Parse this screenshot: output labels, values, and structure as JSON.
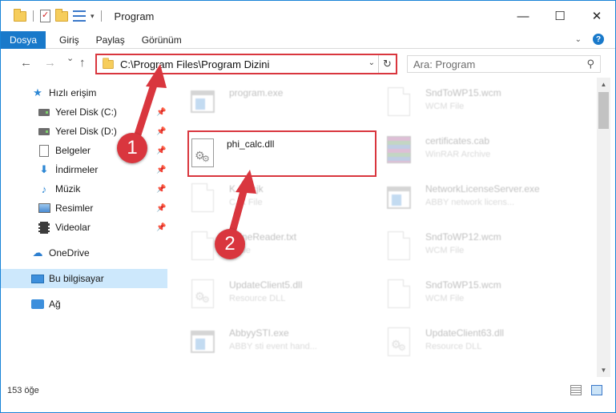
{
  "window": {
    "title": "Program",
    "minimize": "—",
    "maximize": "☐",
    "close": "✕"
  },
  "ribbon": {
    "file_tab": "Dosya",
    "tabs": [
      "Giriş",
      "Paylaş",
      "Görünüm"
    ],
    "collapse_icon": "chevron-down-icon",
    "help": "?"
  },
  "nav": {
    "back": "←",
    "forward": "→",
    "recent": "⌄",
    "up": "↑",
    "address": "C:\\Program Files\\Program Dizini",
    "dropdown": "⌄",
    "refresh": "↻"
  },
  "search": {
    "placeholder": "Ara: Program",
    "icon": "⚲"
  },
  "sidebar": {
    "items": [
      {
        "label": "Hızlı erişim",
        "icon": "star-icon",
        "glyph": "★"
      },
      {
        "label": "Yerel Disk (C:)",
        "icon": "drive-icon",
        "glyph": "",
        "pinned": true
      },
      {
        "label": "Yerel Disk (D:)",
        "icon": "drive-icon",
        "glyph": "",
        "pinned": true
      },
      {
        "label": "Belgeler",
        "icon": "documents-icon",
        "glyph": "",
        "pinned": true
      },
      {
        "label": "İndirmeler",
        "icon": "download-icon",
        "glyph": "⬇",
        "pinned": true
      },
      {
        "label": "Müzik",
        "icon": "music-icon",
        "glyph": "♪",
        "pinned": true
      },
      {
        "label": "Resimler",
        "icon": "pictures-icon",
        "glyph": "",
        "pinned": true
      },
      {
        "label": "Videolar",
        "icon": "videos-icon",
        "glyph": "",
        "pinned": true
      },
      {
        "label": "OneDrive",
        "icon": "cloud-icon",
        "glyph": "☁"
      },
      {
        "label": "Bu bilgisayar",
        "icon": "computer-icon",
        "glyph": "",
        "selected": true
      },
      {
        "label": "Ağ",
        "icon": "network-icon",
        "glyph": ""
      }
    ],
    "pin_glyph": "📌"
  },
  "files": [
    {
      "name": "program.exe",
      "type": "",
      "icon": "exe-icon"
    },
    {
      "name": "SndToWP15.wcm",
      "type": "WCM File",
      "icon": "blank-file-icon"
    },
    {
      "name": "phi_calc.dll",
      "type": "",
      "icon": "dll-gear-icon",
      "highlight": true
    },
    {
      "name": "certificates.cab",
      "type": "WinRAR Archive",
      "icon": "archive-icon"
    },
    {
      "name": "K...n.cjk",
      "type": "CJK File",
      "icon": "blank-file-icon"
    },
    {
      "name": "NetworkLicenseServer.exe",
      "type": "ABBY network licens...",
      "icon": "exe-icon"
    },
    {
      "name": "...fineReader.txt",
      "type": "...File",
      "icon": "blank-file-icon"
    },
    {
      "name": "SndToWP12.wcm",
      "type": "WCM File",
      "icon": "blank-file-icon"
    },
    {
      "name": "UpdateClient5.dll",
      "type": "Resource DLL",
      "icon": "dll-gear-icon"
    },
    {
      "name": "SndToWP15.wcm",
      "type": "WCM File",
      "icon": "blank-file-icon"
    },
    {
      "name": "AbbyySTI.exe",
      "type": "ABBY sti event hand...",
      "icon": "exe-icon"
    },
    {
      "name": "UpdateClient63.dll",
      "type": "Resource DLL",
      "icon": "dll-gear-icon"
    }
  ],
  "status": {
    "count": "153 öğe"
  },
  "annotations": {
    "badge1": "1",
    "badge2": "2",
    "color": "#d9363e"
  },
  "colors": {
    "accent": "#1979ca",
    "selection": "#cde8fc"
  }
}
